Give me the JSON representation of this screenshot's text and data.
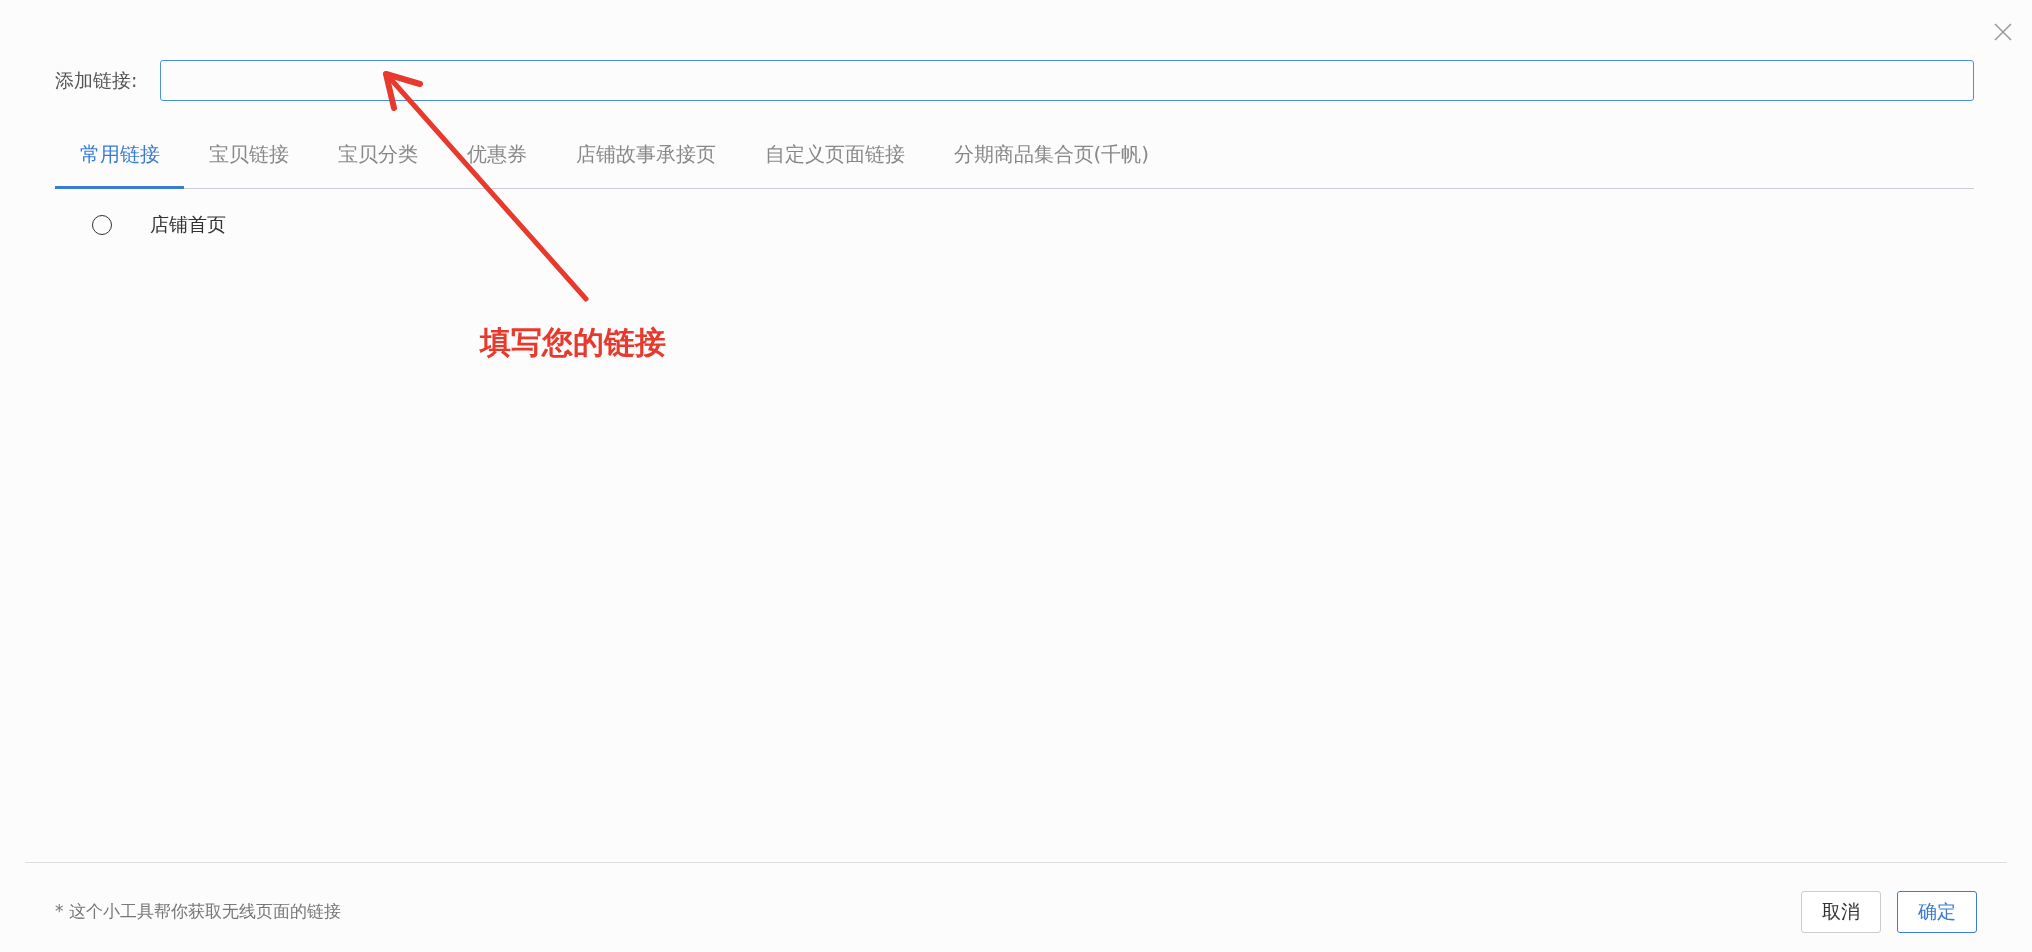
{
  "link_field": {
    "label": "添加链接:"
  },
  "tabs": [
    {
      "label": "常用链接",
      "selected": true
    },
    {
      "label": "宝贝链接",
      "selected": false
    },
    {
      "label": "宝贝分类",
      "selected": false
    },
    {
      "label": "优惠券",
      "selected": false
    },
    {
      "label": "店铺故事承接页",
      "selected": false
    },
    {
      "label": "自定义页面链接",
      "selected": false
    },
    {
      "label": "分期商品集合页(千帆)",
      "selected": false
    }
  ],
  "options": [
    {
      "label": "店铺首页",
      "selected": false
    }
  ],
  "annotation": {
    "text": "填写您的链接"
  },
  "footer": {
    "note": "* 这个小工具帮你获取无线页面的链接",
    "buttons": [
      {
        "label": "取消",
        "kind": "default"
      },
      {
        "label": "确定",
        "kind": "primary"
      }
    ]
  }
}
